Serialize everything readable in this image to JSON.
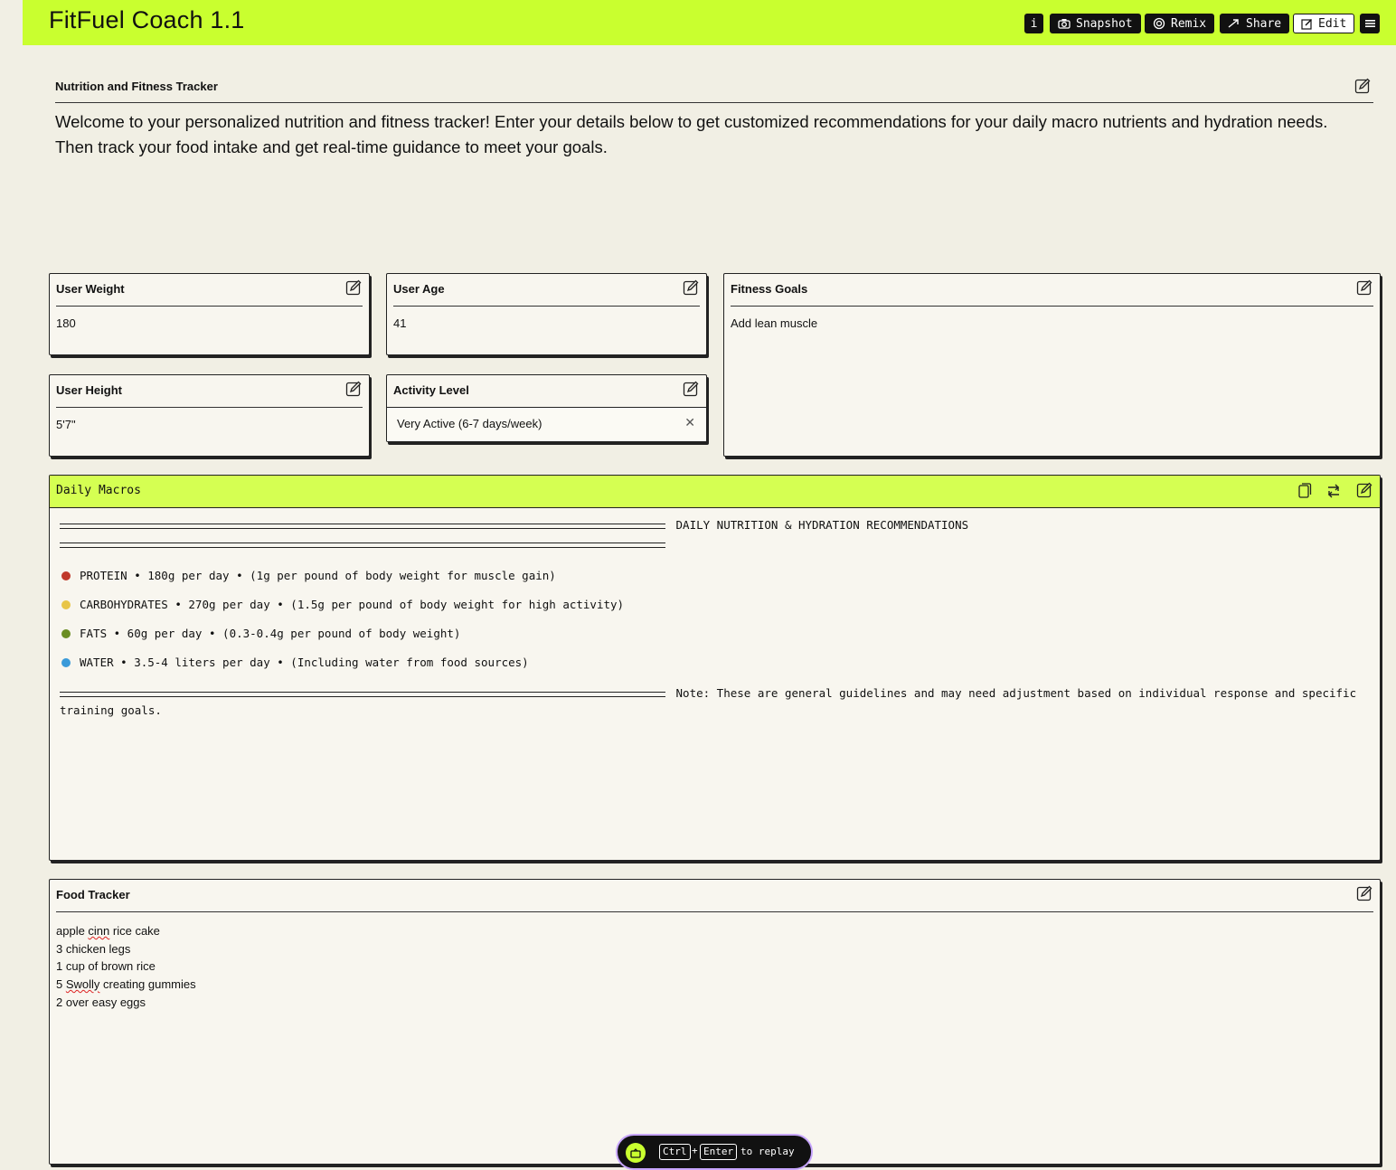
{
  "app": {
    "title": "FitFuel Coach 1.1"
  },
  "toolbar": {
    "info_label": "i",
    "snapshot_label": "Snapshot",
    "remix_label": "Remix",
    "share_label": "Share",
    "edit_label": "Edit"
  },
  "intro": {
    "heading": "Nutrition and Fitness Tracker",
    "text": "Welcome to your personalized nutrition and fitness tracker! Enter your details below to get customized recommendations for your daily macro nutrients and hydration needs. Then track your food intake and get real-time guidance to meet your goals."
  },
  "fields": {
    "weight": {
      "label": "User Weight",
      "value": "180"
    },
    "age": {
      "label": "User Age",
      "value": "41"
    },
    "height": {
      "label": "User Height",
      "value": "5'7\""
    },
    "activity": {
      "label": "Activity Level",
      "value": "Very Active (6-7 days/week)"
    },
    "goals": {
      "label": "Fitness Goals",
      "value": "Add lean muscle"
    }
  },
  "macros": {
    "title": "Daily Macros",
    "header": "DAILY NUTRITION & HYDRATION RECOMMENDATIONS",
    "items": [
      {
        "icon": "meat-icon",
        "color": "#c0392b",
        "text": "PROTEIN • 180g per day • (1g per pound of body weight for muscle gain)"
      },
      {
        "icon": "corn-icon",
        "color": "#e8c547",
        "text": "CARBOHYDRATES • 270g per day • (1.5g per pound of body weight for high activity)"
      },
      {
        "icon": "avocado-icon",
        "color": "#6b8e23",
        "text": "FATS • 60g per day • (0.3-0.4g per pound of body weight)"
      },
      {
        "icon": "water-drop-icon",
        "color": "#3a9ad9",
        "text": "WATER • 3.5-4 liters per day • (Including water from food sources)"
      }
    ],
    "note": "Note: These are general guidelines and may need adjustment based on individual response and specific",
    "note_cont": "training goals."
  },
  "food": {
    "title": "Food Tracker",
    "lines": [
      {
        "pre": "apple ",
        "misspelled": "cinn",
        "post": " rice cake"
      },
      {
        "pre": "3 chicken legs",
        "misspelled": "",
        "post": ""
      },
      {
        "pre": "1 cup of brown rice",
        "misspelled": "",
        "post": ""
      },
      {
        "pre": "5 ",
        "misspelled": "Swolly",
        "post": " creating gummies"
      },
      {
        "pre": "2 over easy eggs",
        "misspelled": "",
        "post": ""
      }
    ]
  },
  "replay": {
    "key1": "Ctrl",
    "plus": "+",
    "key2": "Enter",
    "suffix": "to replay"
  },
  "colors": {
    "accent": "#c9ff2f",
    "accent_light": "#d5ff52",
    "background": "#f1efe4",
    "dark": "#111111"
  }
}
